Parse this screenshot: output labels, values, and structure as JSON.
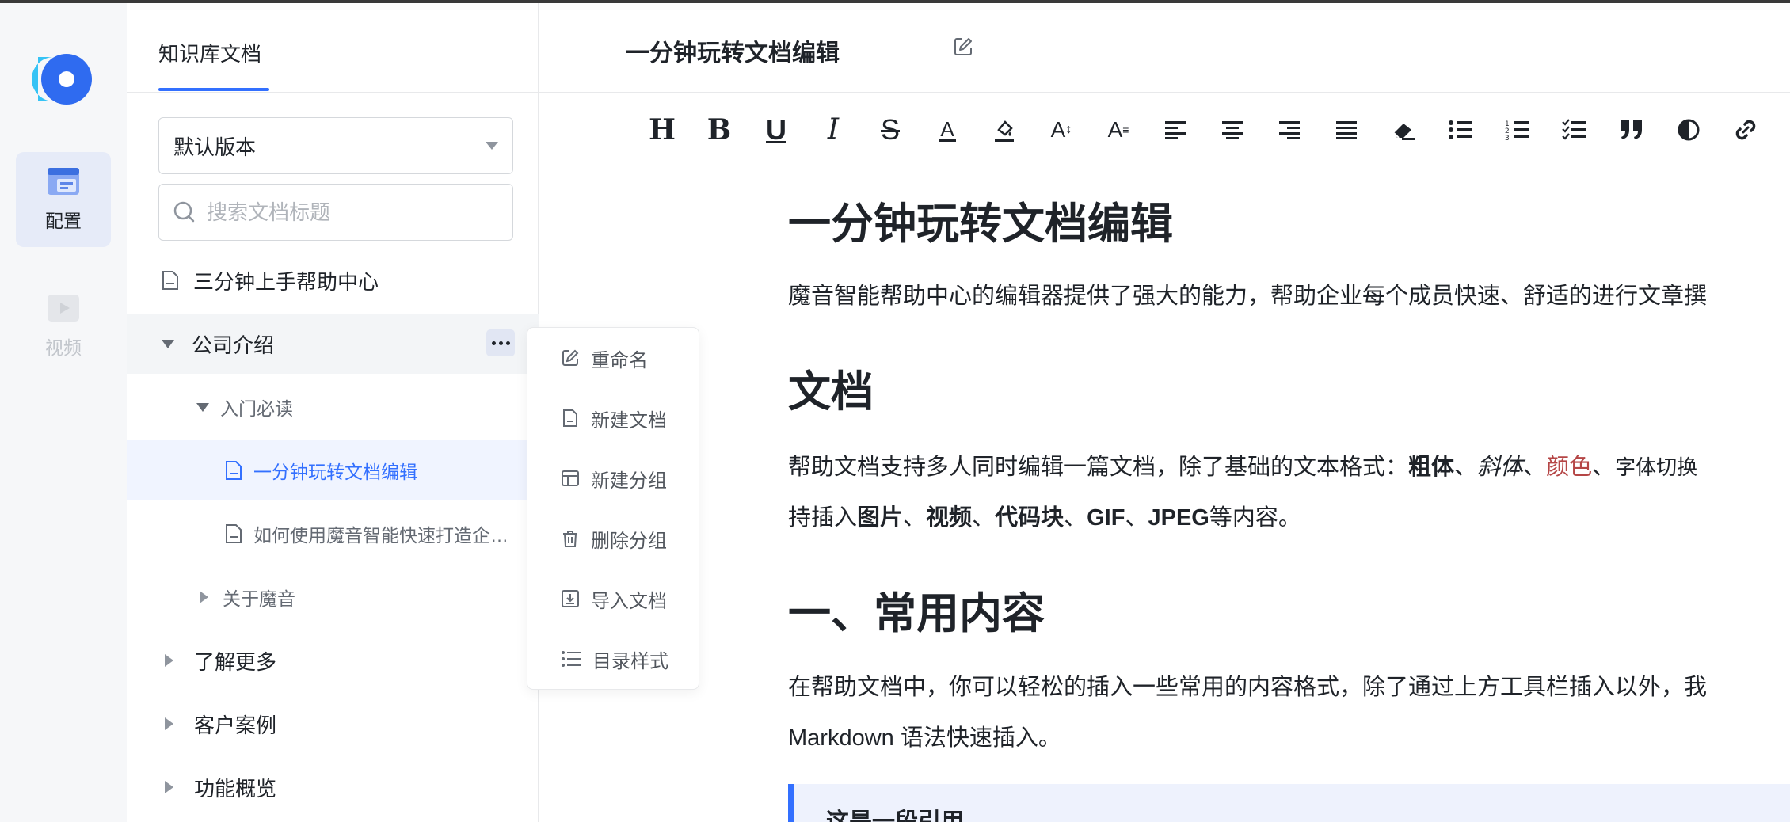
{
  "nav": {
    "items": [
      {
        "label": "配置",
        "active": true
      },
      {
        "label": "视频",
        "active": false
      }
    ]
  },
  "sidebar": {
    "tab": "知识库文档",
    "version": "默认版本",
    "search_placeholder": "搜索文档标题",
    "tree": [
      {
        "label": "三分钟上手帮助中心",
        "type": "doc"
      },
      {
        "label": "公司介绍",
        "type": "group",
        "expanded": true
      },
      {
        "label": "入门必读",
        "type": "group",
        "expanded": true
      },
      {
        "label": "一分钟玩转文档编辑",
        "type": "doc",
        "selected": true
      },
      {
        "label": "如何使用魔音智能快速打造企业帮助中心",
        "type": "doc"
      },
      {
        "label": "关于魔音",
        "type": "group",
        "expanded": false
      },
      {
        "label": "了解更多",
        "type": "group",
        "expanded": false
      },
      {
        "label": "客户案例",
        "type": "group",
        "expanded": false
      },
      {
        "label": "功能概览",
        "type": "group",
        "expanded": false
      }
    ]
  },
  "context_menu": {
    "items": [
      {
        "label": "重命名",
        "icon": "rename-icon"
      },
      {
        "label": "新建文档",
        "icon": "new-doc-icon"
      },
      {
        "label": "新建分组",
        "icon": "new-group-icon"
      },
      {
        "label": "删除分组",
        "icon": "trash-icon"
      },
      {
        "label": "导入文档",
        "icon": "import-icon"
      },
      {
        "label": "目录样式",
        "icon": "list-icon"
      }
    ]
  },
  "header": {
    "doc_title": "一分钟玩转文档编辑"
  },
  "toolbar": {
    "buttons": [
      {
        "name": "heading",
        "glyph": "H"
      },
      {
        "name": "bold",
        "glyph": "B"
      },
      {
        "name": "underline",
        "glyph": "U"
      },
      {
        "name": "italic",
        "glyph": "I"
      },
      {
        "name": "strikethrough",
        "glyph": "S"
      },
      {
        "name": "font-color",
        "glyph": "A"
      },
      {
        "name": "highlight"
      },
      {
        "name": "font-size",
        "glyph": "A"
      },
      {
        "name": "font-family",
        "glyph": "A"
      },
      {
        "name": "align-left"
      },
      {
        "name": "align-center"
      },
      {
        "name": "align-right"
      },
      {
        "name": "align-justify"
      },
      {
        "name": "clear-format"
      },
      {
        "name": "bullet-list"
      },
      {
        "name": "ordered-list"
      },
      {
        "name": "task-list"
      },
      {
        "name": "quote"
      },
      {
        "name": "contrast"
      },
      {
        "name": "link"
      }
    ]
  },
  "document": {
    "h1": "一分钟玩转文档编辑",
    "intro": "魔音智能帮助中心的编辑器提供了强大的能力，帮助企业每个成员快速、舒适的进行文章撰",
    "section1_title": "文档",
    "section1_p1_a": "帮助文档支持多人同时编辑一篇文档，除了基础的文本格式：",
    "bold": "粗体",
    "sep1": "、",
    "italic": "斜体",
    "sep2": "、",
    "color": "颜色",
    "sep3": "、",
    "font_switch": "字体切换",
    "section1_p2_a": "持插入",
    "images": "图片",
    "sep4": "、",
    "video": "视频",
    "sep5": "、",
    "codeblock": "代码块",
    "sep6": "、",
    "gif": "GIF",
    "sep7": "、",
    "jpeg": "JPEG",
    "section1_p2_b": "等内容。",
    "section2_title": "一、常用内容",
    "section2_p1": "在帮助文档中，你可以轻松的插入一些常用的内容格式，除了通过上方工具栏插入以外，我",
    "section2_p2": "Markdown 语法快速插入。",
    "quote": "这是一段引用"
  },
  "colors": {
    "accent": "#3370ff",
    "selected_text": "#3370ff",
    "red_text": "#b54646"
  }
}
